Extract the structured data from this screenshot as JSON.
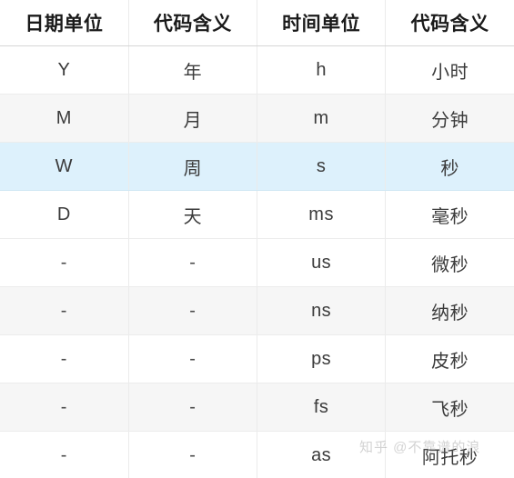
{
  "table": {
    "columns": [
      {
        "key": "date_unit",
        "label": "日期单位"
      },
      {
        "key": "date_meaning",
        "label": "代码含义"
      },
      {
        "key": "time_unit",
        "label": "时间单位"
      },
      {
        "key": "time_meaning",
        "label": "代码含义"
      }
    ],
    "rows": [
      {
        "date_unit": "Y",
        "date_meaning": "年",
        "time_unit": "h",
        "time_meaning": "小时",
        "style": "white"
      },
      {
        "date_unit": "M",
        "date_meaning": "月",
        "time_unit": "m",
        "time_meaning": "分钟",
        "style": "gray"
      },
      {
        "date_unit": "W",
        "date_meaning": "周",
        "time_unit": "s",
        "time_meaning": "秒",
        "style": "highlight"
      },
      {
        "date_unit": "D",
        "date_meaning": "天",
        "time_unit": "ms",
        "time_meaning": "毫秒",
        "style": "white"
      },
      {
        "date_unit": "-",
        "date_meaning": "-",
        "time_unit": "us",
        "time_meaning": "微秒",
        "style": "white"
      },
      {
        "date_unit": "-",
        "date_meaning": "-",
        "time_unit": "ns",
        "time_meaning": "纳秒",
        "style": "gray"
      },
      {
        "date_unit": "-",
        "date_meaning": "-",
        "time_unit": "ps",
        "time_meaning": "皮秒",
        "style": "white"
      },
      {
        "date_unit": "-",
        "date_meaning": "-",
        "time_unit": "fs",
        "time_meaning": "飞秒",
        "style": "gray"
      },
      {
        "date_unit": "-",
        "date_meaning": "-",
        "time_unit": "as",
        "time_meaning": "阿托秒",
        "style": "white"
      }
    ]
  },
  "watermark": {
    "text": "知乎 @不靠谱的浪"
  },
  "colors": {
    "header_text": "#1a1a1a",
    "body_text": "#3b3b3b",
    "row_white": "#ffffff",
    "row_gray": "#f6f6f6",
    "row_highlight": "#ddf1fc",
    "border": "#ebebeb",
    "header_border": "#d6d6d6"
  }
}
